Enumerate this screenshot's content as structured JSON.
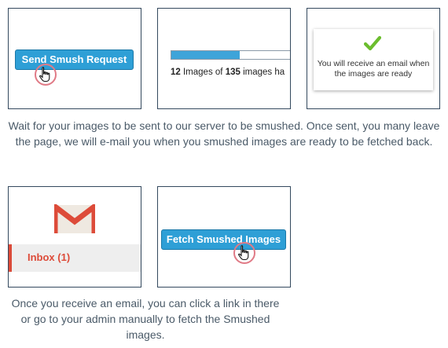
{
  "steps": {
    "send": {
      "button_label": "Send Smush Request"
    },
    "progress": {
      "processed": "12",
      "text_mid": " Images of ",
      "total": "135",
      "text_end": " images ha",
      "fraction": 0.55
    },
    "notice": {
      "message": "You will receive an email when the images are ready"
    },
    "gmail": {
      "inbox_label": "Inbox (1)"
    },
    "fetch": {
      "button_label": "Fetch Smushed Images"
    }
  },
  "captions": {
    "first": "Wait for your images to be sent to our server to be smushed. Once sent, you many leave the page, we will e-mail you when you smushed images are ready to be fetched back.",
    "second": "Once you receive an email, you can click a link in there or go to your admin manually to fetch the Smushed images."
  },
  "colors": {
    "button": "#2e9fd6",
    "progress_fill": "#3ea4d9",
    "check": "#6bbd2e",
    "gmail_red": "#dd4b39"
  },
  "icons": [
    "hand-pointer-icon",
    "checkmark-icon",
    "gmail-icon"
  ]
}
